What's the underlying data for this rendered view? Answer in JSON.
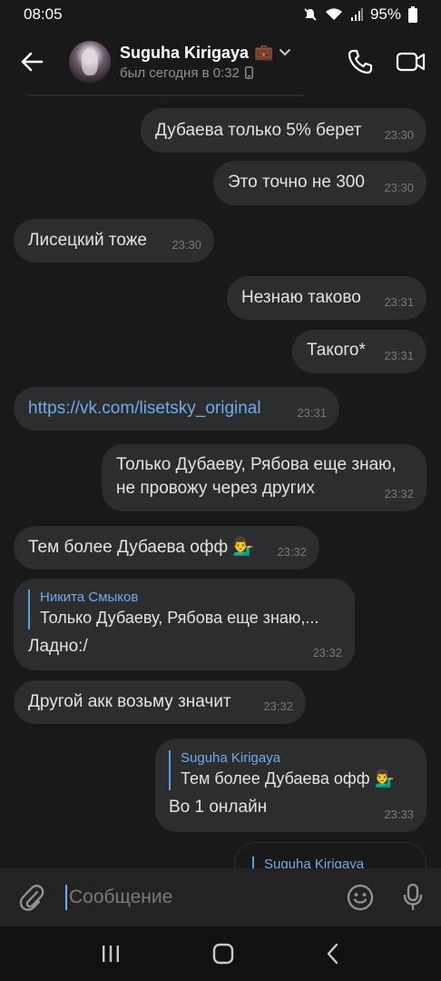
{
  "status": {
    "time": "08:05",
    "battery": "95%"
  },
  "header": {
    "name": "Suguha Kirigaya",
    "badge": "💼",
    "last_seen": "был сегодня в 0:32"
  },
  "messages": [
    {
      "text": "Дубаева только 5% берет",
      "time": "23:30",
      "dir": "out"
    },
    {
      "text": "Это точно не 300",
      "time": "23:30",
      "dir": "out"
    },
    {
      "text": "Лисецкий тоже",
      "time": "23:30",
      "dir": "in"
    },
    {
      "text": "Незнаю таково",
      "time": "23:31",
      "dir": "out"
    },
    {
      "text": "Такого*",
      "time": "23:31",
      "dir": "out"
    },
    {
      "text": "https://vk.com/lisetsky_original",
      "time": "23:31",
      "dir": "in"
    },
    {
      "line1": "Только Дубаеву, Рябова еще знаю,",
      "line2": "не провожу через других",
      "time": "23:32",
      "dir": "out"
    },
    {
      "text": "Тем более Дубаева офф",
      "emoji": "💁‍♂️",
      "time": "23:32",
      "dir": "in"
    },
    {
      "reply_name": "Никита Смыков",
      "reply_text": "Только Дубаеву, Рябова еще знаю,...",
      "text": "Ладно:/",
      "time": "23:32",
      "dir": "in"
    },
    {
      "text": "Другой акк возьму значит",
      "time": "23:32",
      "dir": "in"
    },
    {
      "reply_name": "Suguha Kirigaya",
      "reply_text": "Тем более Дубаева офф",
      "reply_emoji": "💁‍♂️",
      "text": "Во 1 онлайн",
      "time": "23:33",
      "dir": "out"
    },
    {
      "reply_name": "Suguha Kirigaya",
      "dir": "out",
      "partial": true
    }
  ],
  "input": {
    "placeholder": "Сообщение"
  },
  "colors": {
    "bg": "#19191a",
    "bubble": "#2c2d2e",
    "accent": "#71aaeb",
    "time": "#76787a"
  },
  "icons": [
    "back-arrow-icon",
    "chevron-down-icon",
    "phone-icon",
    "video-camera-icon",
    "attach-icon",
    "emoji-icon",
    "microphone-icon",
    "recents-icon",
    "home-icon",
    "nav-back-icon"
  ]
}
